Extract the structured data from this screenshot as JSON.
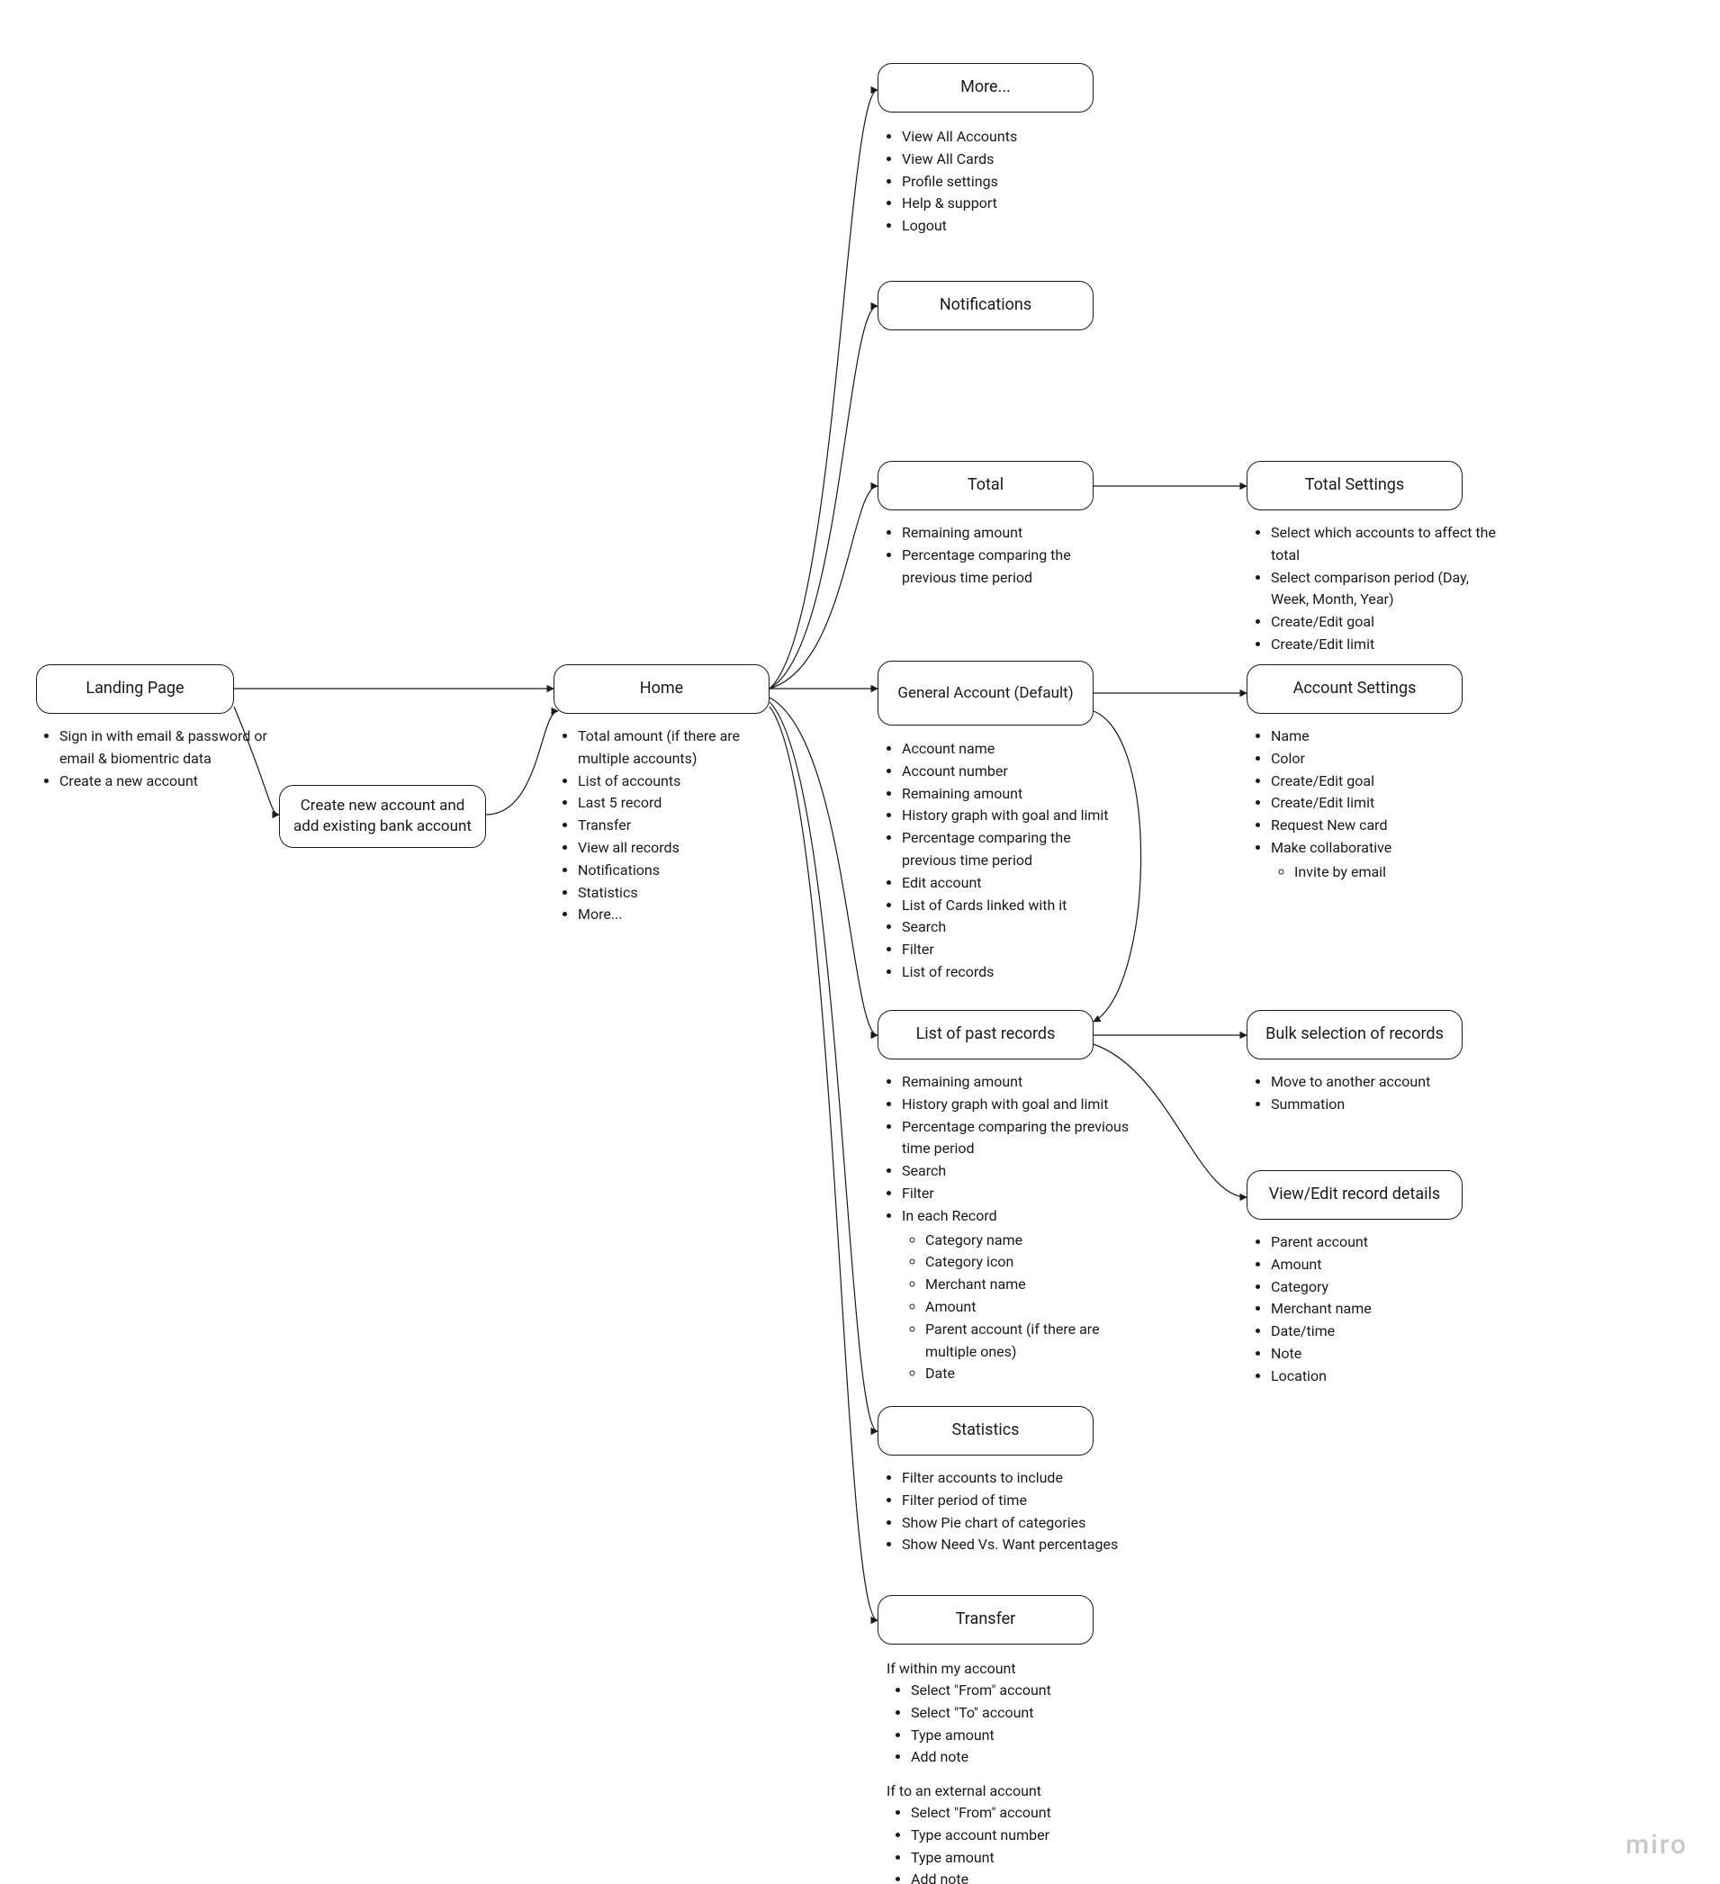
{
  "watermark": "miro",
  "nodes": {
    "landing": {
      "title": "Landing Page"
    },
    "createAcc": {
      "title": "Create new account and add existing bank account"
    },
    "home": {
      "title": "Home"
    },
    "more": {
      "title": "More..."
    },
    "notifications": {
      "title": "Notifications"
    },
    "total": {
      "title": "Total"
    },
    "totalSettings": {
      "title": "Total Settings"
    },
    "generalAccount": {
      "title": "General Account (Default)"
    },
    "accountSettings": {
      "title": "Account Settings"
    },
    "pastRecords": {
      "title": "List of past records"
    },
    "bulkSelection": {
      "title": "Bulk selection of records"
    },
    "viewEditRecord": {
      "title": "View/Edit record details"
    },
    "statistics": {
      "title": "Statistics"
    },
    "transfer": {
      "title": "Transfer"
    }
  },
  "lists": {
    "landing": [
      "Sign in with email & password or email & biomentric data",
      "Create a new account"
    ],
    "home": [
      "Total amount (if there are multiple accounts)",
      "List of accounts",
      "Last 5 record",
      "Transfer",
      "View all records",
      "Notifications",
      "Statistics",
      "More..."
    ],
    "more": [
      "View All Accounts",
      "View All Cards",
      "Profile settings",
      "Help & support",
      "Logout"
    ],
    "total": [
      "Remaining amount",
      "Percentage comparing the previous time period"
    ],
    "totalSettings": [
      "Select which accounts to affect the total",
      "Select comparison period (Day, Week, Month, Year)",
      "Create/Edit goal",
      "Create/Edit limit"
    ],
    "generalAccount": [
      "Account name",
      "Account number",
      "Remaining amount",
      "History graph with goal and limit",
      "Percentage comparing the previous time period",
      "Edit account",
      "List of Cards linked with it",
      "Search",
      "Filter",
      "List of records"
    ],
    "accountSettings": [
      "Name",
      "Color",
      "Create/Edit goal",
      "Create/Edit limit",
      "Request New card",
      "Make collaborative"
    ],
    "accountSettingsSub": [
      "Invite by email"
    ],
    "pastRecords": [
      "Remaining amount",
      "History graph with goal and limit",
      "Percentage comparing the previous time period",
      "Search",
      "Filter",
      "In each Record"
    ],
    "pastRecordsSub": [
      "Category name",
      "Category icon",
      "Merchant name",
      "Amount",
      "Parent account (if there are multiple ones)",
      "Date"
    ],
    "bulkSelection": [
      "Move to another account",
      "Summation"
    ],
    "viewEditRecord": [
      "Parent account",
      "Amount",
      "Category",
      "Merchant name",
      "Date/time",
      "Note",
      "Location"
    ],
    "statistics": [
      "Filter accounts to include",
      "Filter period of time",
      "Show Pie chart of categories",
      "Show Need Vs. Want percentages"
    ],
    "transferIntroA": "If within my account",
    "transferA": [
      "Select \"From\" account",
      "Select \"To\" account",
      "Type amount",
      "Add note"
    ],
    "transferIntroB": "If to an external account",
    "transferB": [
      "Select \"From\" account",
      "Type account number",
      "Type amount",
      "Add note"
    ]
  }
}
